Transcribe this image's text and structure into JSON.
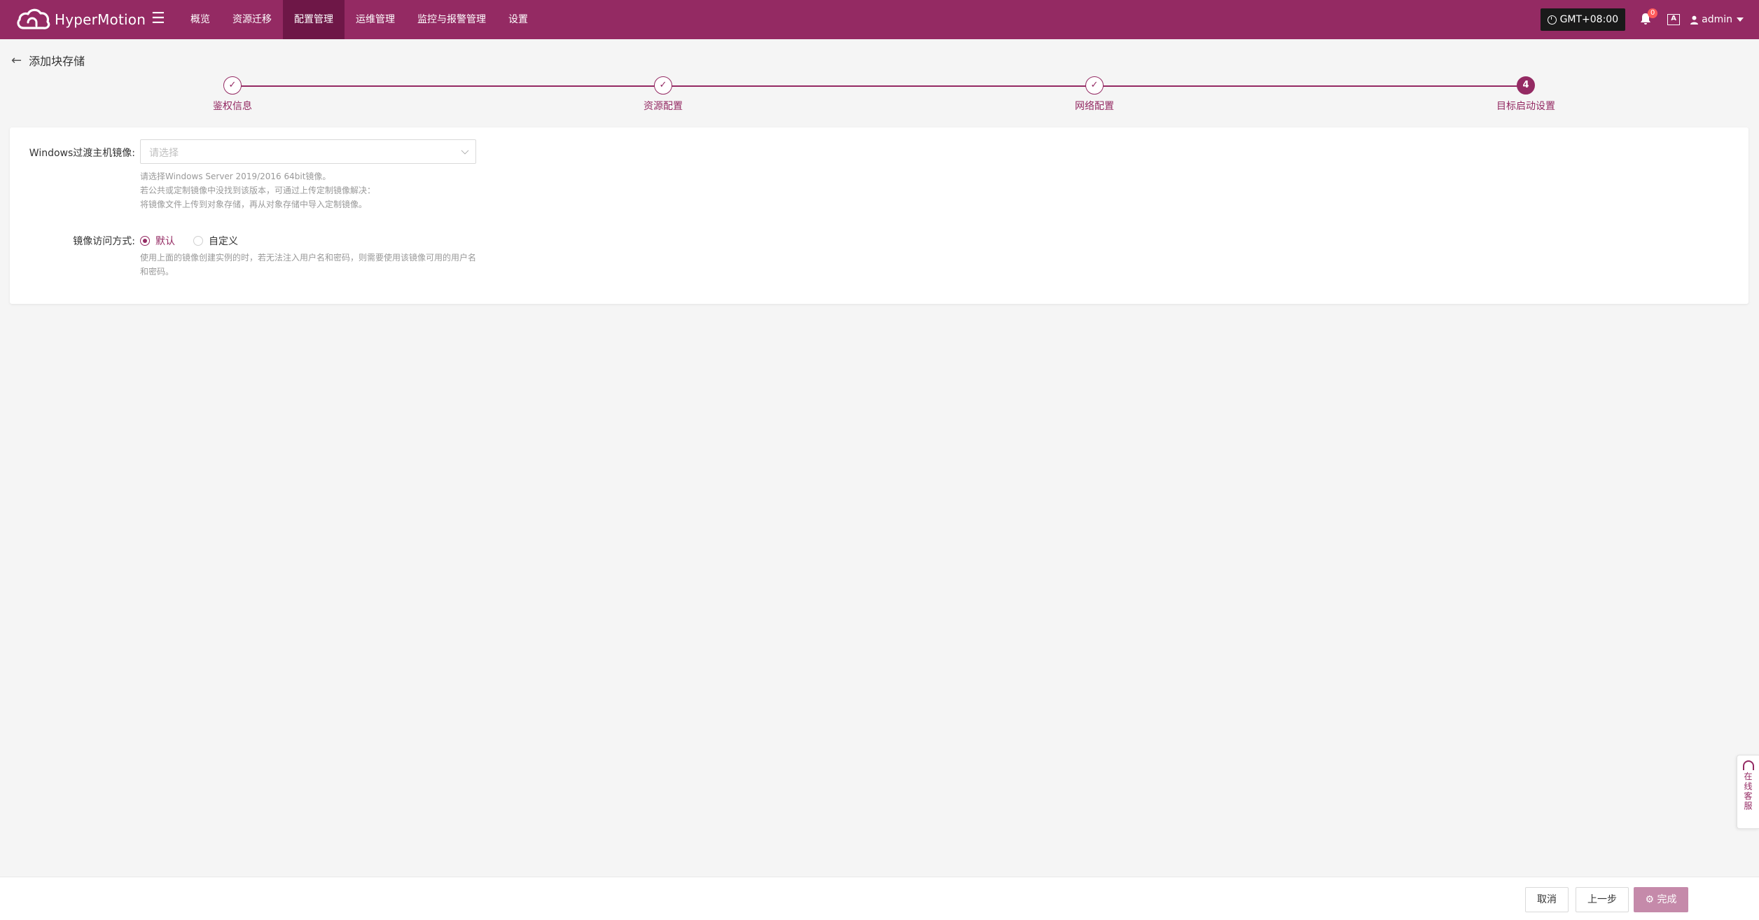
{
  "app": {
    "name": "HyperMotion",
    "brand_color": "#942a63"
  },
  "nav": {
    "menu_icon": "hamburger-icon",
    "items": [
      {
        "label": "概览",
        "active": false
      },
      {
        "label": "资源迁移",
        "active": false
      },
      {
        "label": "配置管理",
        "active": true
      },
      {
        "label": "运维管理",
        "active": false
      },
      {
        "label": "监控与报警管理",
        "active": false
      },
      {
        "label": "设置",
        "active": false
      }
    ]
  },
  "header_tools": {
    "timezone": "GMT+08:00",
    "notification_count": "0",
    "lang_icon_text": "A",
    "user": "admin"
  },
  "page": {
    "title": "添加块存储"
  },
  "steps": [
    {
      "label": "鉴权信息",
      "status": "done"
    },
    {
      "label": "资源配置",
      "status": "done"
    },
    {
      "label": "网络配置",
      "status": "done"
    },
    {
      "label": "目标启动设置",
      "status": "current",
      "number": "4"
    }
  ],
  "form": {
    "image_label": "Windows过渡主机镜像:",
    "image_placeholder": "请选择",
    "image_hints": [
      "请选择Windows Server 2019/2016 64bit镜像。",
      "若公共或定制镜像中没找到该版本，可通过上传定制镜像解决：",
      "将镜像文件上传到对象存储，再从对象存储中导入定制镜像。"
    ],
    "access_label": "镜像访问方式:",
    "access_options": [
      {
        "label": "默认",
        "checked": true
      },
      {
        "label": "自定义",
        "checked": false
      }
    ],
    "access_hints": [
      "使用上面的镜像创建实例的时，若无法注入用户名和密码，则需要使用该镜像可用的用户名",
      "和密码。"
    ]
  },
  "footer": {
    "cancel": "取消",
    "prev": "上一步",
    "finish": "完成"
  },
  "service": {
    "label": "在线客服"
  }
}
